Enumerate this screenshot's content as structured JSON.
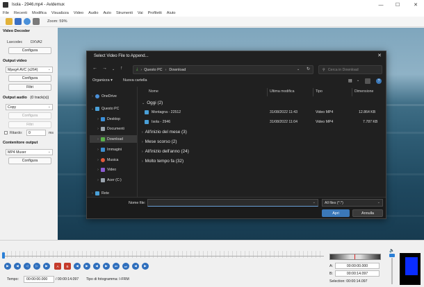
{
  "window": {
    "title": "Isola - 2946.mp4 - Avidemux"
  },
  "menu": [
    "File",
    "Recenti",
    "Modifica",
    "Visualizza",
    "Video",
    "Audio",
    "Auto",
    "Strumenti",
    "Vai",
    "Profiletti",
    "Aiuto"
  ],
  "toolbar": {
    "zoom": "Zoom: 59%"
  },
  "left_panel": {
    "video_decoder": {
      "title": "Video Decoder",
      "label": "Lavcodec",
      "value": "DXVA2",
      "configure": "Configura"
    },
    "output_video": {
      "title": "Output video",
      "codec": "Mpeg4 AVC (x264)",
      "configure": "Configura",
      "filters": "Filtri"
    },
    "output_audio": {
      "title": "Output audio",
      "tracks": "(0 track(s))",
      "codec": "Copy",
      "configure": "Configura",
      "filters": "Filtri",
      "delay_label": "Ritardo:",
      "delay_value": "0",
      "delay_unit": "ms"
    },
    "output_container": {
      "title": "Contenitore output",
      "format": "MP4 Muxer",
      "configure": "Configura"
    }
  },
  "dialog": {
    "title": "Select Video File to Append...",
    "breadcrumb": [
      "Questo PC",
      "Download"
    ],
    "search_placeholder": "Cerca in Download",
    "organize": "Organizza ▾",
    "new_folder": "Nuova cartella",
    "nav_items": [
      {
        "label": "OneDrive",
        "icon": "cloud-icon"
      },
      {
        "label": "Questo PC",
        "icon": "computer-icon"
      },
      {
        "label": "Desktop",
        "icon": "desktop-icon"
      },
      {
        "label": "Documenti",
        "icon": "documents-icon"
      },
      {
        "label": "Download",
        "icon": "download-icon"
      },
      {
        "label": "Immagini",
        "icon": "images-icon"
      },
      {
        "label": "Musica",
        "icon": "music-icon"
      },
      {
        "label": "Video",
        "icon": "video-icon"
      },
      {
        "label": "Acer (C:)",
        "icon": "drive-icon"
      },
      {
        "label": "Rete",
        "icon": "network-icon"
      }
    ],
    "columns": {
      "name": "Nome",
      "modified": "Ultima modifica",
      "type": "Tipo",
      "size": "Dimensione"
    },
    "groups": {
      "today": "Oggi (2)",
      "this_month": "All'inizio del mese (3)",
      "last_month": "Mese scorso (2)",
      "this_year": "All'inizio dell'anno (24)",
      "long_ago": "Molto tempo fa (32)"
    },
    "files": [
      {
        "name": "Montagna - 22512",
        "modified": "31/08/2022 11:43",
        "type": "Video MP4",
        "size": "12.864 KB"
      },
      {
        "name": "Isola - 2946",
        "modified": "31/08/2022 11:04",
        "type": "Video MP4",
        "size": "7.787 KB"
      }
    ],
    "filename_label": "Nome file:",
    "filename_value": "",
    "filter": "All files (*.*)",
    "open": "Apri",
    "cancel": "Annulla"
  },
  "bottom": {
    "time_label": "Tempo:",
    "current_time": "00:00:00.000",
    "total_time": "/ 00:00:14.097",
    "frame_type": "Tipo di fotogramma: I-FRM",
    "a_label": "A:",
    "a_value": "00:00:00.000",
    "b_label": "B:",
    "b_value": "00:00:14.097",
    "selection": "Selection: 00:00:14.097"
  }
}
